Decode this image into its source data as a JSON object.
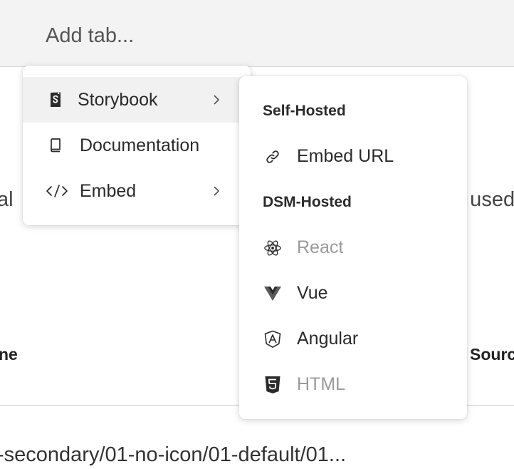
{
  "tab_bar": {
    "add_tab_label": "Add tab..."
  },
  "background": {
    "left_desc_fragment": "al",
    "right_desc_fragment": "e used",
    "left_column_header": "ne",
    "right_column_header": "Sourc",
    "story_path": "-secondary/01-no-icon/01-default/01..."
  },
  "primary_menu": {
    "items": [
      {
        "label": "Storybook",
        "icon": "storybook-icon",
        "has_submenu": true,
        "active": true
      },
      {
        "label": "Documentation",
        "icon": "book-icon",
        "has_submenu": false,
        "active": false
      },
      {
        "label": "Embed",
        "icon": "code-icon",
        "has_submenu": true,
        "active": false
      }
    ]
  },
  "submenu": {
    "self_hosted_heading": "Self-Hosted",
    "dsm_hosted_heading": "DSM-Hosted",
    "items": [
      {
        "label": "Embed URL",
        "icon": "link-icon",
        "disabled": false
      },
      {
        "label": "React",
        "icon": "react-icon",
        "disabled": true
      },
      {
        "label": "Vue",
        "icon": "vue-icon",
        "disabled": false
      },
      {
        "label": "Angular",
        "icon": "angular-icon",
        "disabled": false
      },
      {
        "label": "HTML",
        "icon": "html5-icon",
        "disabled": true
      }
    ]
  },
  "colors": {
    "menu_active_bg": "#f1f1f1",
    "disabled_text": "#9a9a9a",
    "text": "#2b2b2b"
  }
}
